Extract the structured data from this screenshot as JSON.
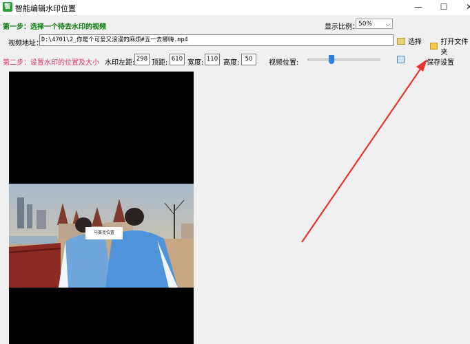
{
  "window": {
    "title": "智能编辑水印位置",
    "app_icon_glyph": "智",
    "minimize": "—",
    "maximize": "☐",
    "close": "✕"
  },
  "step1": {
    "heading": "第一步：选择一个待去水印的视频",
    "scale_label": "显示比例：",
    "scale_value": "50%",
    "path_label": "视频地址：",
    "path_value": "D:\\4701\\2_你是个可爱又浪漫的麻烦#五一去哪嗨.mp4",
    "select_button": "选择",
    "open_folder_button": "打开文件夹"
  },
  "step2": {
    "heading": "第二步：设置水印的位置及大小",
    "left_label": "水印左距:",
    "left_value": "298",
    "top_label": "顶距:",
    "top_value": "610",
    "width_label": "宽度:",
    "width_value": "110",
    "height_label": "高度:",
    "height_value": "50",
    "position_label": "视频位置:",
    "position_fraction": 0.32,
    "save_button": "保存设置"
  },
  "video": {
    "watermark_text": "马赛克位置"
  },
  "colors": {
    "step1": "#0a7a0a",
    "step2": "#e0336f",
    "arrow": "#e8322c",
    "slider_thumb": "#2f7de1"
  },
  "icons": [
    "app-icon",
    "search-icon",
    "folder-icon",
    "copy-icon",
    "chevron-down-icon"
  ]
}
